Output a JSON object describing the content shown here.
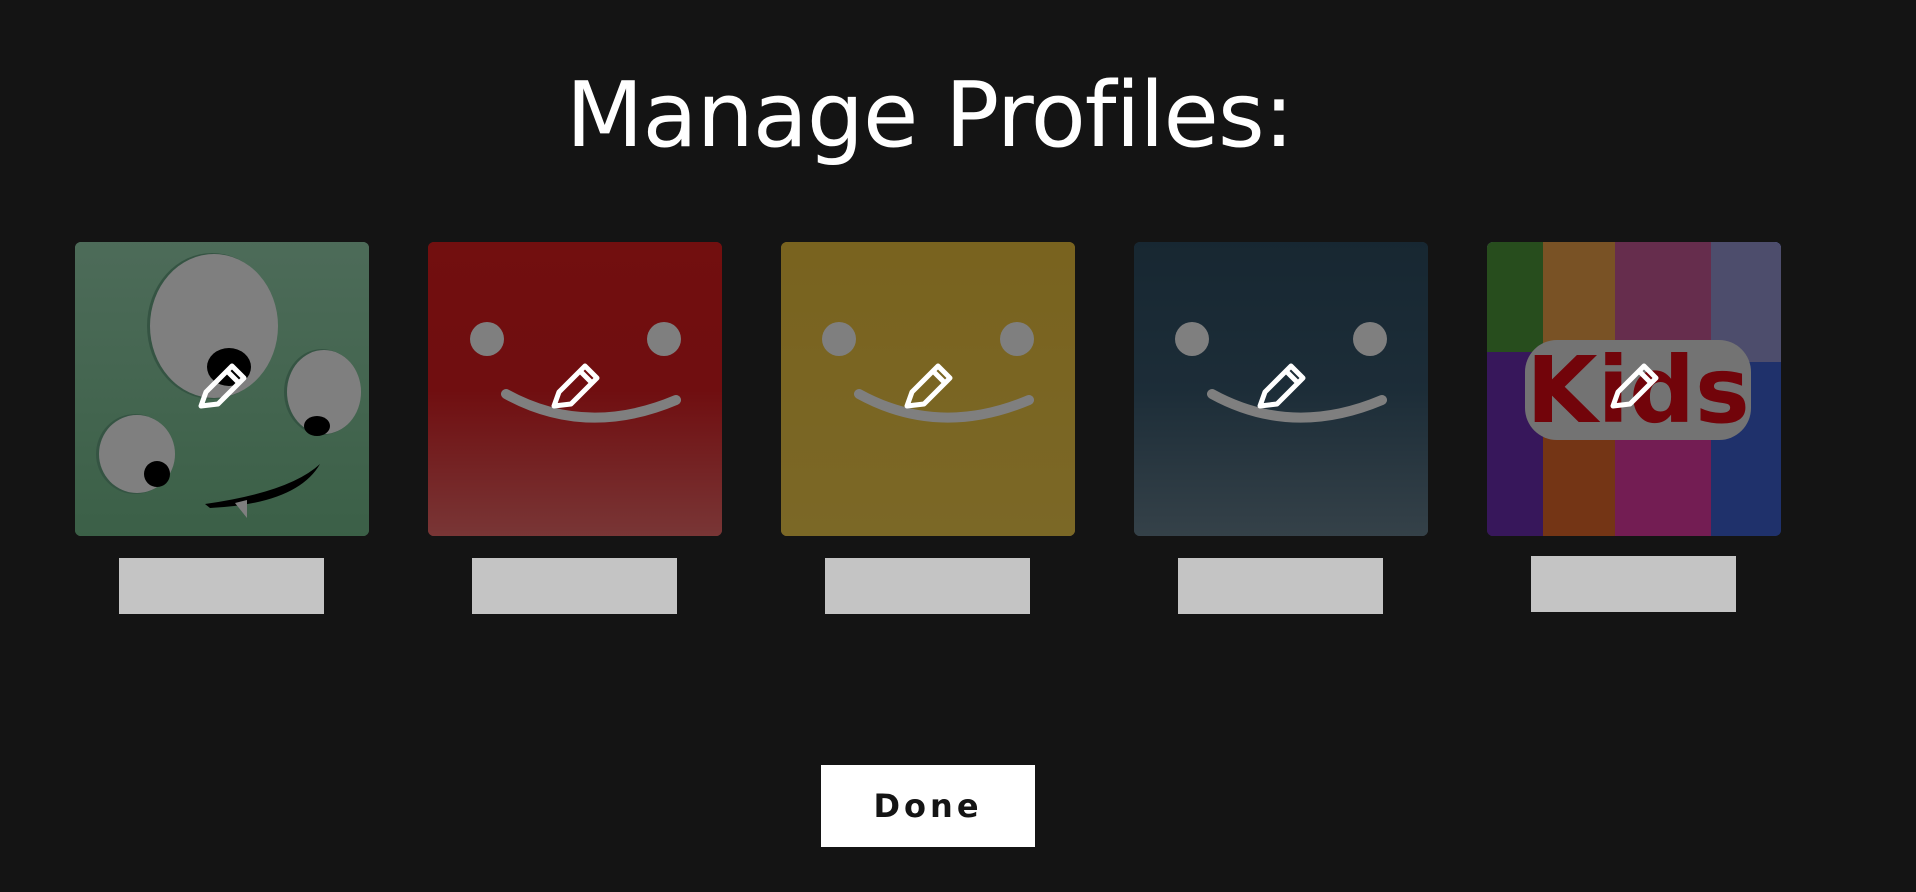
{
  "page": {
    "title": "Manage Profiles:"
  },
  "profiles": [
    {
      "avatar": "green-monster-avatar",
      "name": "",
      "edit_icon": "pencil-icon"
    },
    {
      "avatar": "red-smiley-avatar",
      "name": "",
      "edit_icon": "pencil-icon"
    },
    {
      "avatar": "yellow-smiley-avatar",
      "name": "",
      "edit_icon": "pencil-icon"
    },
    {
      "avatar": "dark-blue-smiley-avatar",
      "name": "",
      "edit_icon": "pencil-icon"
    },
    {
      "avatar": "kids-avatar",
      "avatar_text": "Kids",
      "name": "",
      "edit_icon": "pencil-icon"
    }
  ],
  "actions": {
    "done_label": "Done"
  },
  "colors": {
    "background": "#141414",
    "green_avatar": "#2e7d52",
    "red_avatar": "#e50914",
    "yellow_avatar": "#f5c518",
    "blue_avatar": "#1c3448",
    "name_field": "#c4c4c4",
    "button_bg": "#ffffff"
  }
}
